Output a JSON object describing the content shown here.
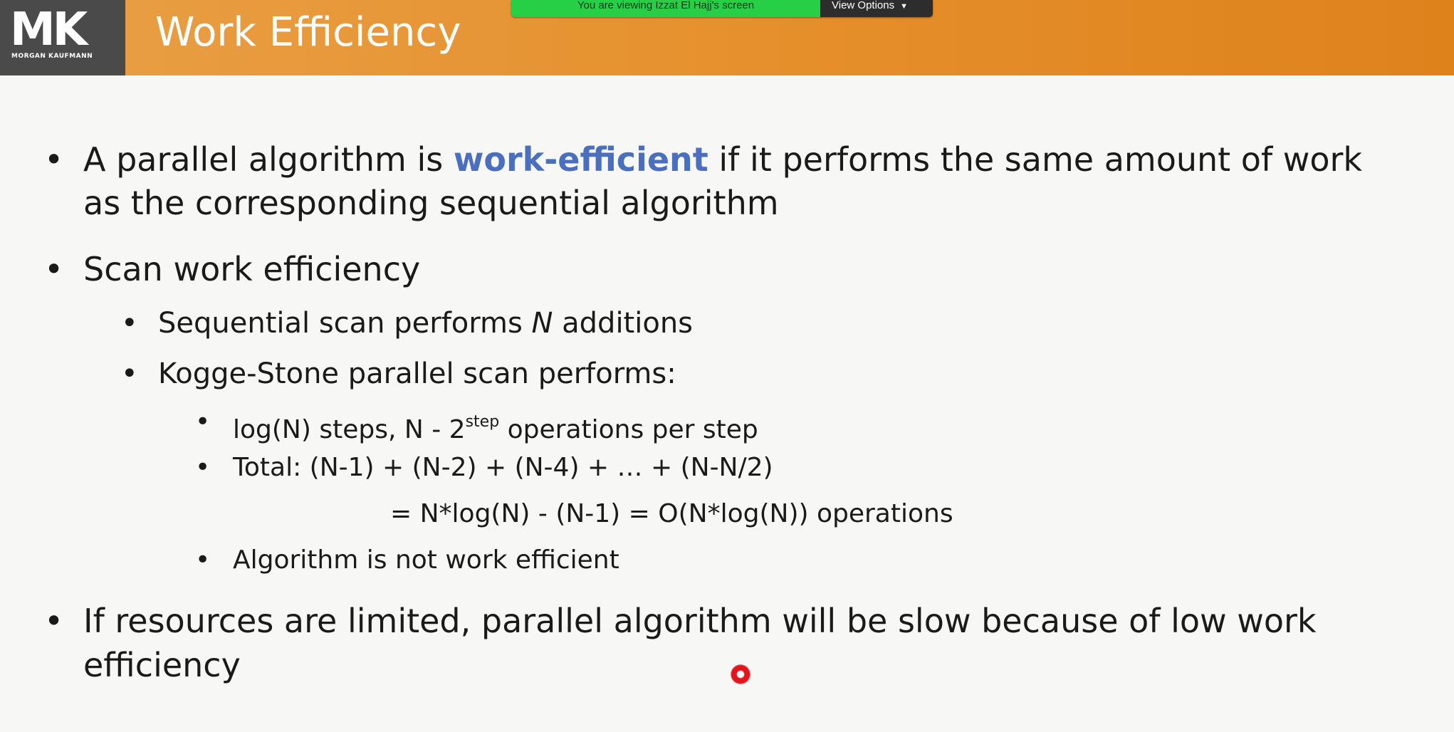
{
  "header": {
    "logo_text": "MK",
    "logo_subtext": "MORGAN KAUFMANN",
    "title": "Work Efficiency"
  },
  "share_banner": {
    "text": "You are viewing Izzat El Hajj's screen",
    "view_options_label": "View Options"
  },
  "slide": {
    "b1": {
      "pre": "A parallel algorithm is ",
      "term": "work-efficient",
      "post": " if it performs the same amount of work",
      "line2": "as the corresponding sequential algorithm"
    },
    "b2": "Scan work efficiency",
    "b2_1": {
      "pre": "Sequential scan performs ",
      "var": "N",
      "post": " additions"
    },
    "b2_2": "Kogge-Stone parallel scan performs:",
    "b2_2_1": {
      "pre": "log(N) steps, N - 2",
      "sup": "step",
      "post": " operations per step"
    },
    "b2_2_2": {
      "line1": "Total: (N-1) + (N-2) + (N-4) + … + (N-N/2)",
      "line2": "= N*log(N) - (N-1) = O(N*log(N)) operations"
    },
    "b2_2_3": "Algorithm is not work efficient",
    "b3": {
      "line1": "If resources are limited, parallel algorithm will be slow because of low work",
      "line2": "efficiency"
    }
  },
  "bullet_glyph": "•",
  "colors": {
    "header_orange": "#e58f2b",
    "logo_gray": "#4a4a4a",
    "accent_blue": "#4a6fbf",
    "share_green": "#27cf46",
    "laser_red": "#e3141b"
  }
}
